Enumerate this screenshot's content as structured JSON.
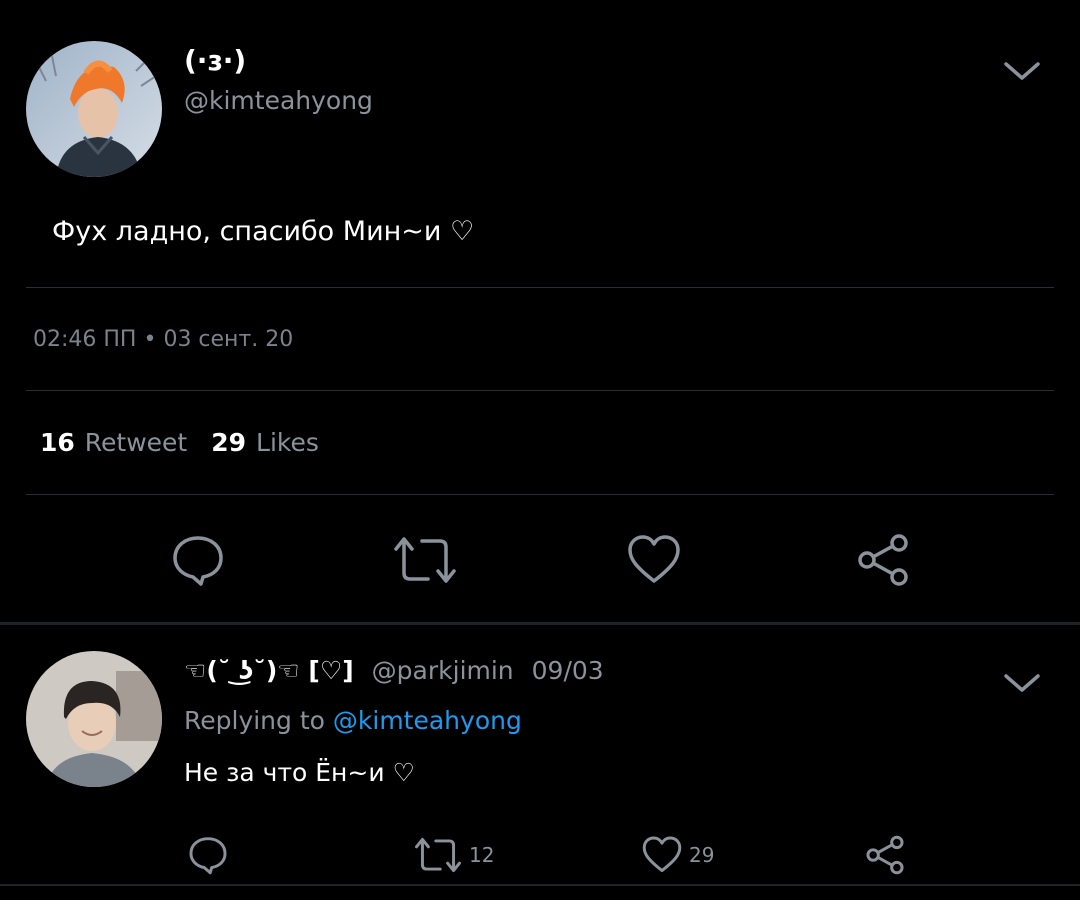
{
  "main_tweet": {
    "display_name": "(·ɜ·)",
    "handle": "@kimteahyong",
    "text": "Фух ладно, спасибо Мин~и ♡",
    "timestamp": "02:46 ПП • 03 сент. 20",
    "retweets_count": "16",
    "retweets_label": "Retweet",
    "likes_count": "29",
    "likes_label": "Likes",
    "icons": [
      "chat-bubble-icon",
      "retweet-icon",
      "heart-icon",
      "share-icon",
      "chevron-down-icon"
    ]
  },
  "reply_tweet": {
    "display_name": "☜(˘ ͜ʖ˘)☜ [♡]",
    "handle": "@parkjimin",
    "date": "09/03",
    "replying_prefix": "Replying to",
    "replying_handle": "@kimteahyong",
    "text": "Не за что Ён~и ♡",
    "retweet_count": "12",
    "like_count": "29"
  },
  "colors": {
    "background": "#000000",
    "text_primary": "#ffffff",
    "text_secondary": "#8a939c",
    "link": "#1d9bf0",
    "divider": "#2a2e33"
  }
}
